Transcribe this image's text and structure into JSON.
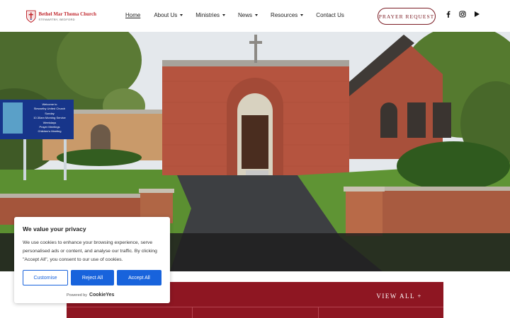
{
  "brand": {
    "title": "Bethel Mar Thoma Church",
    "subtitle": "STEWARTBY, BEDFORD"
  },
  "nav": {
    "items": [
      {
        "label": "Home",
        "has_dropdown": false,
        "active": true
      },
      {
        "label": "About Us",
        "has_dropdown": true,
        "active": false
      },
      {
        "label": "Ministries",
        "has_dropdown": true,
        "active": false
      },
      {
        "label": "News",
        "has_dropdown": true,
        "active": false
      },
      {
        "label": "Resources",
        "has_dropdown": true,
        "active": false
      },
      {
        "label": "Contact Us",
        "has_dropdown": false,
        "active": false
      }
    ],
    "cta_label": "PRAYER REQUEST",
    "social_icons": [
      "facebook-icon",
      "instagram-icon",
      "youtube-icon"
    ]
  },
  "hero": {
    "sign_lines": [
      "Welcome to",
      "Stewartby United Church",
      "Sunday",
      "10.30am Morning Service",
      "Weekdays",
      "Prayer Meetings",
      "Children's Meeting"
    ]
  },
  "section": {
    "view_all_label": "VIEW ALL +"
  },
  "cookie_banner": {
    "title": "We value your privacy",
    "body": "We use cookies to enhance your browsing experience, serve personalised ads or content, and analyse our traffic. By clicking \"Accept All\", you consent to our use of cookies.",
    "customise_label": "Customise",
    "reject_label": "Reject All",
    "accept_label": "Accept All",
    "powered_by": "Powered by",
    "provider": "CookieYes"
  },
  "colors": {
    "brand_red": "#c0272d",
    "maroon": "#8e1622",
    "cookie_blue": "#1863dc"
  }
}
